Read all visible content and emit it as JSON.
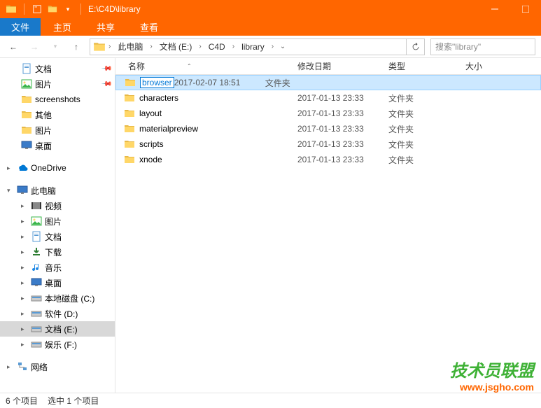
{
  "titlebar": {
    "title": "E:\\C4D\\library"
  },
  "ribbon": {
    "file": "文件",
    "tabs": [
      "主页",
      "共享",
      "查看"
    ]
  },
  "breadcrumb": {
    "segments": [
      "此电脑",
      "文档 (E:)",
      "C4D",
      "library"
    ]
  },
  "search": {
    "placeholder": "搜索\"library\""
  },
  "sidebar": {
    "quick": [
      {
        "label": "文档",
        "icon": "doc",
        "pinned": true
      },
      {
        "label": "图片",
        "icon": "pic",
        "pinned": true
      },
      {
        "label": "screenshots",
        "icon": "folder"
      },
      {
        "label": "其他",
        "icon": "folder"
      },
      {
        "label": "图片",
        "icon": "folder"
      },
      {
        "label": "桌面",
        "icon": "desktop"
      }
    ],
    "onedrive": {
      "label": "OneDrive"
    },
    "thispc": {
      "label": "此电脑",
      "items": [
        {
          "label": "视频",
          "icon": "video"
        },
        {
          "label": "图片",
          "icon": "pic"
        },
        {
          "label": "文档",
          "icon": "doc"
        },
        {
          "label": "下载",
          "icon": "download"
        },
        {
          "label": "音乐",
          "icon": "music"
        },
        {
          "label": "桌面",
          "icon": "desktop"
        },
        {
          "label": "本地磁盘 (C:)",
          "icon": "drive"
        },
        {
          "label": "软件 (D:)",
          "icon": "drive"
        },
        {
          "label": "文档 (E:)",
          "icon": "drive",
          "selected": true
        },
        {
          "label": "娱乐 (F:)",
          "icon": "drive"
        }
      ]
    },
    "network": {
      "label": "网络"
    }
  },
  "columns": {
    "name": "名称",
    "date": "修改日期",
    "type": "类型",
    "size": "大小"
  },
  "files": [
    {
      "name": "browser",
      "date": "2017-02-07 18:51",
      "type": "文件夹",
      "selected": true,
      "editing": true
    },
    {
      "name": "characters",
      "date": "2017-01-13 23:33",
      "type": "文件夹"
    },
    {
      "name": "layout",
      "date": "2017-01-13 23:33",
      "type": "文件夹"
    },
    {
      "name": "materialpreview",
      "date": "2017-01-13 23:33",
      "type": "文件夹"
    },
    {
      "name": "scripts",
      "date": "2017-01-13 23:33",
      "type": "文件夹"
    },
    {
      "name": "xnode",
      "date": "2017-01-13 23:33",
      "type": "文件夹"
    }
  ],
  "statusbar": {
    "count": "6 个项目",
    "selected": "选中 1 个项目"
  },
  "watermark": {
    "text": "技术员联盟",
    "url": "www.jsgho.com"
  }
}
